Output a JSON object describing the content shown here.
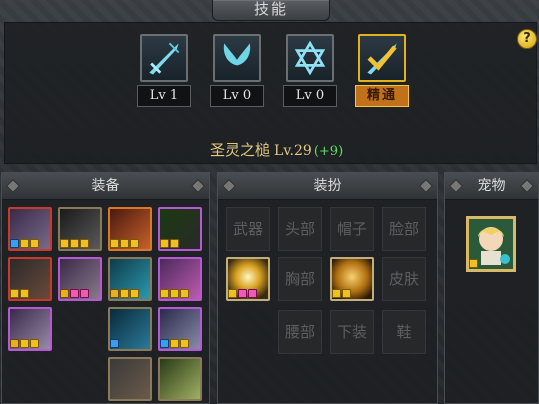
{
  "window": {
    "title": "技能"
  },
  "help_label": "?",
  "skills": [
    {
      "icon": "sword-icon",
      "level_label": "Lv 1"
    },
    {
      "icon": "wings-icon",
      "level_label": "Lv 0"
    },
    {
      "icon": "hexagram-icon",
      "level_label": "Lv 0"
    },
    {
      "icon": "mastery-sword-icon",
      "level_label": "精通"
    }
  ],
  "selected_skill": {
    "name": "圣灵之槌",
    "level": "Lv.29",
    "bonus": "(+9)"
  },
  "equipment": {
    "title": "装备"
  },
  "avatar": {
    "title": "装扮",
    "slots": [
      "武器",
      "头部",
      "帽子",
      "脸部",
      "胸部",
      "皮肤",
      "腰部",
      "下装",
      "鞋"
    ]
  },
  "pet": {
    "title": "宠物"
  },
  "colors": {
    "gold_text": "#e3c97e",
    "bonus_green": "#5fe05f",
    "mastery_orange": "#c0711a"
  }
}
